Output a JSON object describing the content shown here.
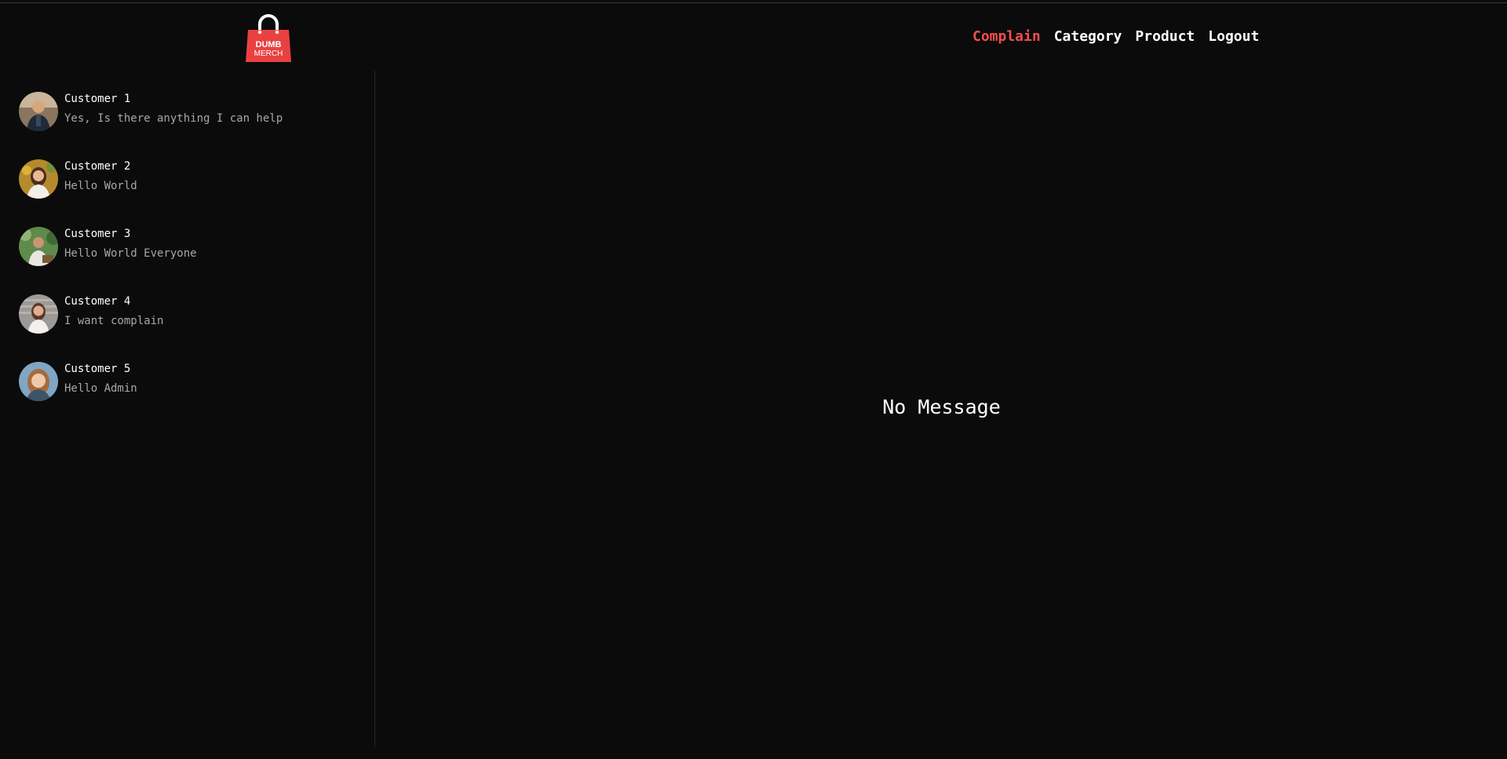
{
  "brand": {
    "logo_line1": "DUMB",
    "logo_line2": "MERCH",
    "accent_color": "#f74d4d"
  },
  "nav": {
    "items": [
      {
        "label": "Complain",
        "active": true
      },
      {
        "label": "Category",
        "active": false
      },
      {
        "label": "Product",
        "active": false
      },
      {
        "label": "Logout",
        "active": false
      }
    ]
  },
  "contacts": [
    {
      "name": "Customer 1",
      "last_message": "Yes, Is there anything I can help",
      "avatar": "avatar-customer-1"
    },
    {
      "name": "Customer 2",
      "last_message": "Hello World",
      "avatar": "avatar-customer-2"
    },
    {
      "name": "Customer 3",
      "last_message": "Hello World Everyone",
      "avatar": "avatar-customer-3"
    },
    {
      "name": "Customer 4",
      "last_message": "I want complain",
      "avatar": "avatar-customer-4"
    },
    {
      "name": "Customer 5",
      "last_message": "Hello Admin",
      "avatar": "avatar-customer-5"
    }
  ],
  "main": {
    "empty_text": "No Message"
  }
}
